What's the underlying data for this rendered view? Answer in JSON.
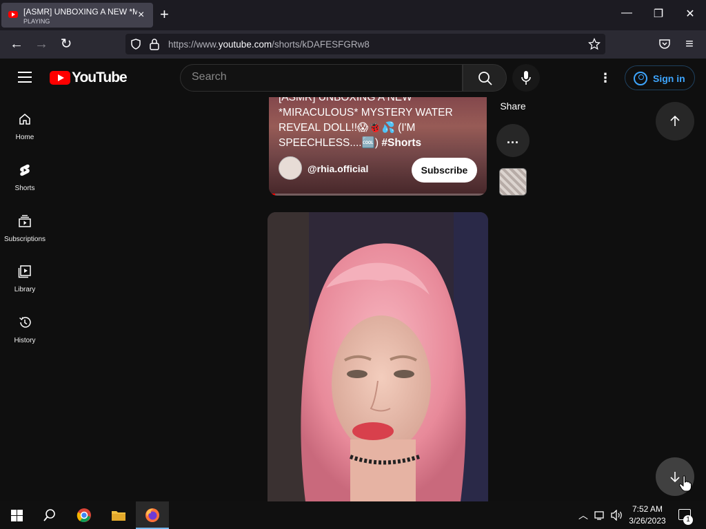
{
  "browser": {
    "tab": {
      "title": "[ASMR] UNBOXING A NEW *MIRACULOUS* MYSTERY WATER REVEAL DOLL",
      "status": "PLAYING",
      "favicon": "youtube-icon"
    },
    "url": {
      "prefix": "https://www.",
      "domain": "youtube.com",
      "path": "/shorts/kDAFESFGRw8"
    }
  },
  "youtube": {
    "logo_text": "YouTube",
    "search_placeholder": "Search",
    "sign_in_label": "Sign in",
    "accent_color": "#3ea6ff",
    "brand_color": "#ff0000"
  },
  "sidebar": {
    "items": [
      {
        "label": "Home",
        "icon": "home-icon"
      },
      {
        "label": "Shorts",
        "icon": "shorts-icon"
      },
      {
        "label": "Subscriptions",
        "icon": "subscriptions-icon"
      },
      {
        "label": "Library",
        "icon": "library-icon"
      },
      {
        "label": "History",
        "icon": "history-icon"
      }
    ]
  },
  "short1": {
    "title_top": "[ASMR] UNBOXING A NEW",
    "title_main": "*MIRACULOUS* MYSTERY WATER REVEAL DOLL!!😱🐞💦 (I'M SPEECHLESS....🆒)",
    "hashtag": "#Shorts",
    "channel": "@rhia.official",
    "subscribe_label": "Subscribe",
    "progress": 0.03
  },
  "actions": {
    "share_label": "Share",
    "more_label": "..."
  },
  "taskbar": {
    "time": "7:52 AM",
    "date": "3/26/2023",
    "notification_count": "1"
  }
}
